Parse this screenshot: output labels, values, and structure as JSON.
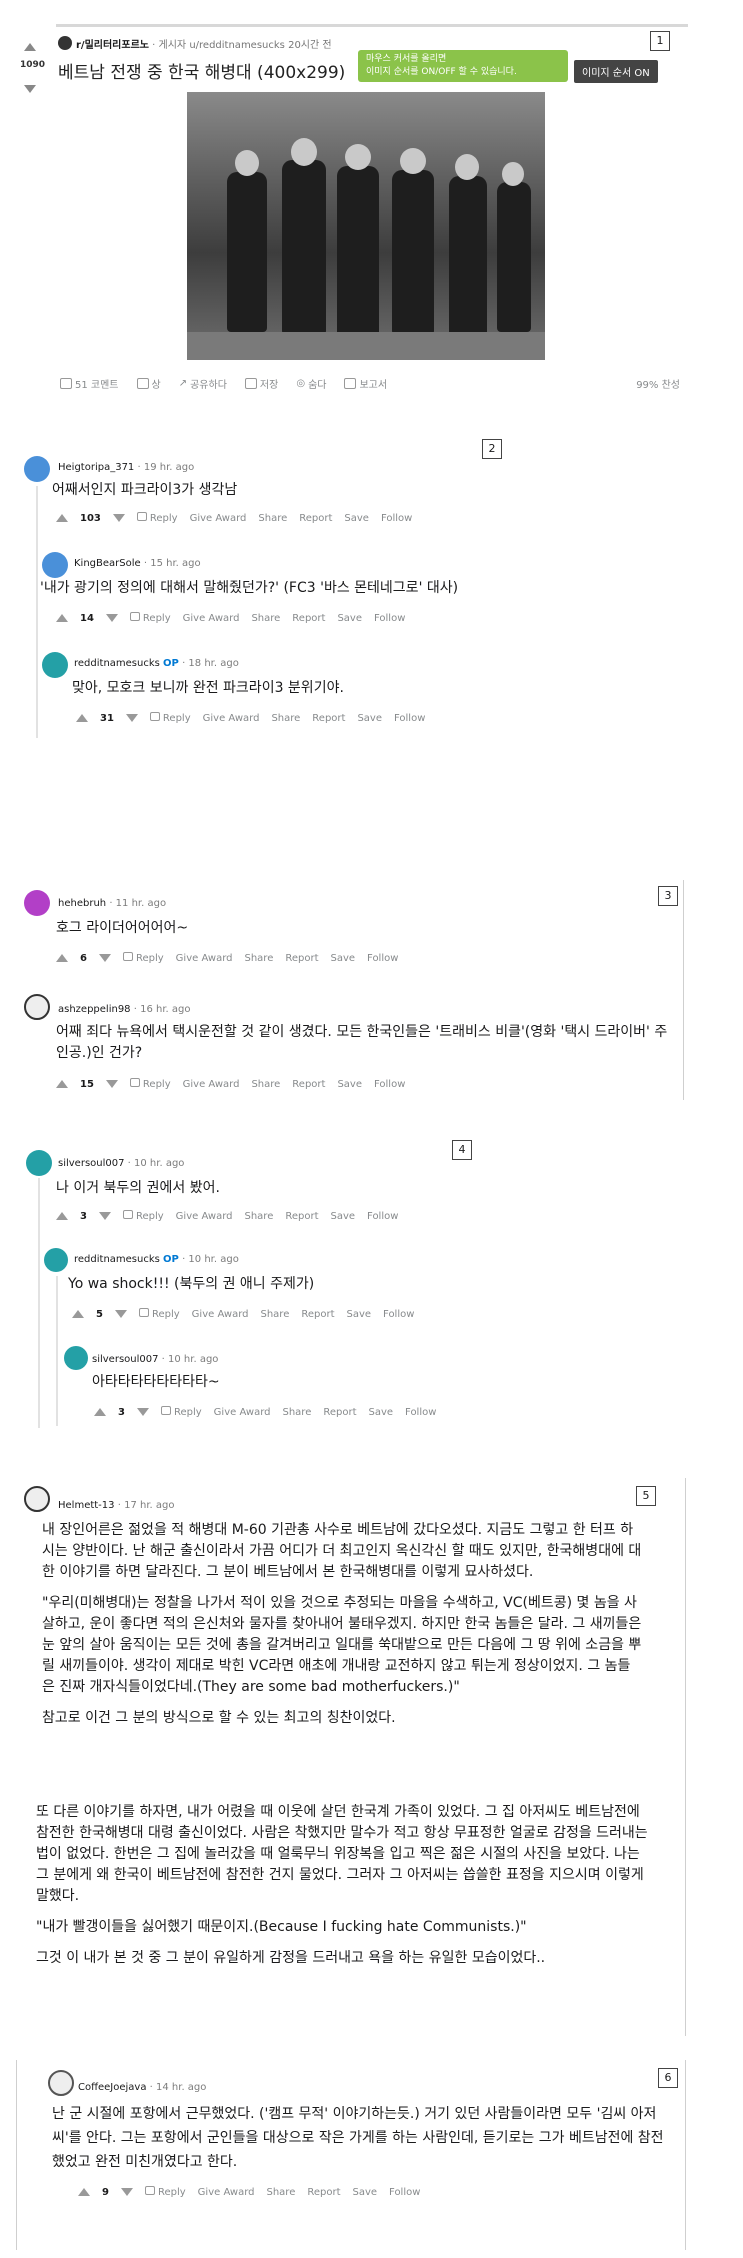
{
  "post": {
    "subreddit": "r/밀리터리포르노",
    "poster_prefix": "· 게시자",
    "poster": "u/redditnamesucks",
    "age": "20시간 전",
    "votes": "1090",
    "title": "베트남 전쟁 중 한국 해병대 (400x299)",
    "tooltip_line1": "마우스 커서를 올리면",
    "tooltip_line2": "이미지 순서를 ON/OFF 할 수 있습니다.",
    "toggle_label": "이미지 순서 ON",
    "actions": [
      "51 코멘트",
      "상",
      "공유하다",
      "저장",
      "숨다",
      "보고서"
    ],
    "upvote_ratio": "99% 찬성"
  },
  "markers": [
    "1",
    "2",
    "3",
    "4",
    "5",
    "6"
  ],
  "comments": [
    {
      "user": "Heigtoripa_371",
      "time": "· 19 hr. ago",
      "text": "어째서인지 파크라이3가 생각남",
      "score": "103"
    },
    {
      "user": "KingBearSole",
      "time": "· 15 hr. ago",
      "text": "'내가 광기의 정의에 대해서 말해줬던가?' (FC3 '바스 몬테네그로' 대사)",
      "score": "14"
    },
    {
      "user": "redditnamesucks",
      "op": "OP",
      "time": "· 18 hr. ago",
      "text": "맞아, 모호크 보니까 완전 파크라이3 분위기야.",
      "score": "31"
    },
    {
      "user": "hehebruh",
      "time": "· 11 hr. ago",
      "text": "호그 라이더어어어어~",
      "score": "6"
    },
    {
      "user": "ashzeppelin98",
      "time": "· 16 hr. ago",
      "text": "어째 죄다 뉴욕에서 택시운전할 것 같이 생겼다. 모든 한국인들은 '트래비스 비클'(영화 '택시 드라이버' 주인공.)인 건가?",
      "score": "15"
    },
    {
      "user": "silversoul007",
      "time": "· 10 hr. ago",
      "text": "나 이거 북두의 권에서 봤어.",
      "score": "3"
    },
    {
      "user": "redditnamesucks",
      "op": "OP",
      "time": "· 10 hr. ago",
      "text": "Yo wa shock!!! (북두의 권 애니 주제가)",
      "score": "5"
    },
    {
      "user": "silversoul007",
      "time": "· 10 hr. ago",
      "text": "아타타타타타타타타~",
      "score": "3"
    },
    {
      "user": "Helmett-13",
      "time": "· 17 hr. ago",
      "paras": [
        "내 장인어른은 젊었을 적 해병대 M-60 기관총 사수로 베트남에 갔다오셨다. 지금도 그렇고 한 터프 하시는 양반이다. 난 해군 출신이라서 가끔 어디가 더 최고인지 옥신각신 할 때도 있지만, 한국해병대에 대한 이야기를 하면 달라진다. 그 분이 베트남에서 본 한국해병대를 이렇게 묘사하셨다.",
        "\"우리(미해병대)는 정찰을 나가서 적이 있을 것으로 추정되는 마을을 수색하고, VC(베트콩) 몇 놈을 사살하고, 운이 좋다면 적의 은신처와 물자를 찾아내어 불태우겠지. 하지만 한국 놈들은 달라. 그 새끼들은 눈 앞의 살아 움직이는 모든 것에 총을 갈겨버리고 일대를 쑥대밭으로 만든 다음에 그 땅 위에 소금을 뿌릴 새끼들이야. 생각이 제대로 박힌 VC라면 애초에 개내랑 교전하지 않고 튀는게 정상이었지. 그 놈들은 진짜 개자식들이었다네.(They are some bad motherfuckers.)\"",
        "참고로 이건 그 분의 방식으로 할 수 있는 최고의 칭찬이었다."
      ],
      "paras2": [
        "또 다른 이야기를 하자면, 내가 어렸을 때 이웃에 살던 한국계 가족이 있었다. 그 집 아저씨도 베트남전에 참전한 한국해병대 대령 출신이었다. 사람은 착했지만 말수가 적고 항상 무표정한 얼굴로 감정을 드러내는 법이 없었다. 한번은 그 집에 놀러갔을 때 얼룩무늬 위장복을 입고 찍은 젊은 시절의 사진을 보았다. 나는 그 분에게 왜 한국이 베트남전에 참전한 건지 물었다. 그러자 그 아저씨는 씁쓸한 표정을 지으시며 이렇게 말했다.",
        "\"내가 빨갱이들을 싫어했기 때문이지.(Because I fucking hate Communists.)\"",
        "그것 이 내가 본 것 중 그 분이 유일하게 감정을 드러내고 욕을 하는 유일한 모습이었다.."
      ]
    },
    {
      "user": "CoffeeJoejava",
      "time": "· 14 hr. ago",
      "text": "난 군 시절에 포항에서 근무했었다. ('캠프 무적' 이야기하는듯.) 거기 있던 사람들이라면 모두 '김씨 아저씨'를 안다. 그는 포항에서 군인들을 대상으로 작은 가게를 하는 사람인데, 듣기로는 그가 베트남전에 참전했었고 완전 미친개였다고 한다.",
      "score": "9"
    }
  ],
  "comment_actions": {
    "reply": "Reply",
    "award": "Give Award",
    "share": "Share",
    "report": "Report",
    "save": "Save",
    "follow": "Follow"
  },
  "colors": {
    "tooltip": "#8bc34a",
    "op_badge": "#0079d3",
    "avatar_teal": "#24a0a6",
    "avatar_blue": "#4a90d9",
    "avatar_purple": "#b23fc7"
  }
}
